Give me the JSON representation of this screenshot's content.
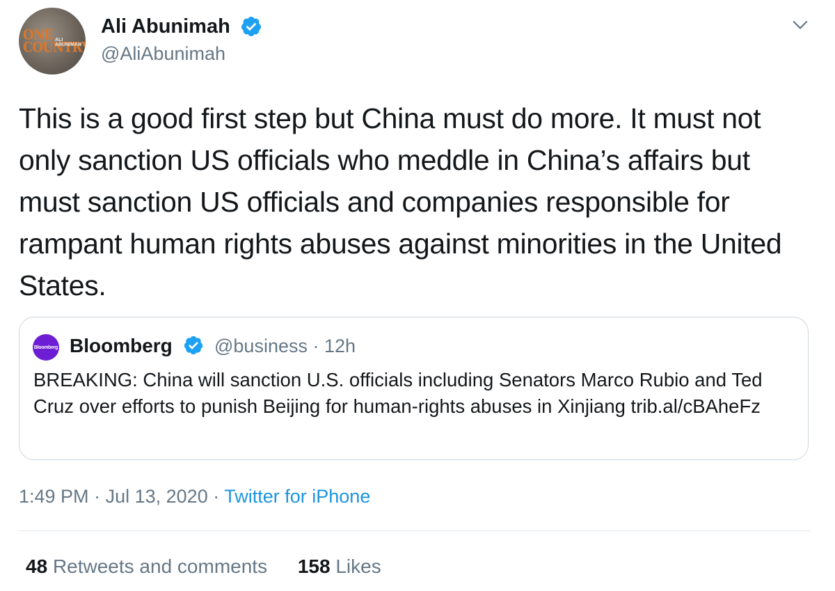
{
  "author": {
    "name": "Ali Abunimah",
    "handle": "@AliAbunimah",
    "avatar_text": "ONE COUNTRY",
    "avatar_subtext": "ALI ABUNIMAH",
    "verified": true
  },
  "tweet": {
    "text": "This is a good first step but China must do more. It must not only sanction US officials who meddle in China’s affairs but must sanction US officials and companies responsible for rampant human rights abuses against minorities in the United States."
  },
  "quoted_tweet": {
    "avatar_text": "Bloomberg",
    "name": "Bloomberg",
    "handle": "@business",
    "separator": "·",
    "time": "12h",
    "text": "BREAKING: China will sanction U.S. officials including Senators Marco Rubio and Ted Cruz over efforts to punish Beijing for human-rights abuses in Xinjiang trib.al/cBAheFz",
    "verified": true
  },
  "meta": {
    "time": "1:49 PM",
    "separator": "·",
    "date": "Jul 13, 2020",
    "source": "Twitter for iPhone"
  },
  "stats": {
    "retweets_count": "48",
    "retweets_label": "Retweets and comments",
    "likes_count": "158",
    "likes_label": "Likes"
  },
  "colors": {
    "accent": "#1da1f2",
    "link": "#1b95e0",
    "secondary_text": "#657786",
    "bloomberg_purple": "#6d1ed4"
  },
  "icons": {
    "verified": "verified-badge-icon",
    "menu": "chevron-down-icon"
  }
}
